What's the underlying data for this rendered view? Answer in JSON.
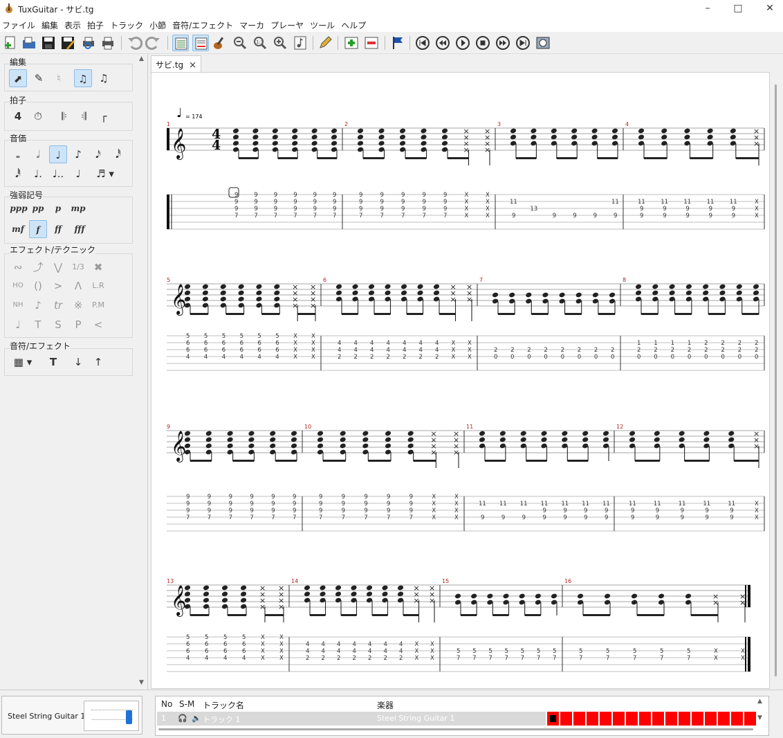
{
  "window": {
    "title": "TuxGuitar - サビ.tg"
  },
  "menu": [
    "ファイル",
    "編集",
    "表示",
    "拍子",
    "トラック",
    "小節",
    "音符/エフェクト",
    "マーカ",
    "プレーヤ",
    "ツール",
    "ヘルプ"
  ],
  "toolbar": {
    "buttons": [
      "new-file-icon",
      "open-file-icon",
      "save-icon",
      "save-as-icon",
      "print-preview-icon",
      "print-icon",
      "undo-icon",
      "redo-icon",
      "score-view-icon",
      "tab-view-icon",
      "fretboard-icon",
      "zoom-out-icon",
      "zoom-reset-icon",
      "zoom-in-icon",
      "note-icon",
      "pencil-icon",
      "add-track-icon",
      "remove-track-icon",
      "marker-flag-icon",
      "first-icon",
      "previous-icon",
      "play-icon",
      "stop-icon",
      "next-icon",
      "last-icon",
      "metronome-icon"
    ]
  },
  "tab": {
    "label": "サビ.tg",
    "close": "×"
  },
  "left_panel": {
    "groups": [
      {
        "label": "編集"
      },
      {
        "label": "拍子"
      },
      {
        "label": "音価"
      },
      {
        "label": "強弱記号",
        "items": [
          "ppp",
          "pp",
          "p",
          "mp",
          "mf",
          "f",
          "ff",
          "fff"
        ]
      },
      {
        "label": "エフェクト/テクニック",
        "items": [
          "1/3",
          "L.R",
          "tr",
          "P.M",
          "T",
          "S",
          "P",
          "<",
          "HO",
          "()",
          ">",
          "NH"
        ]
      },
      {
        "label": "音符/エフェクト"
      }
    ],
    "time_sig_icon": "4"
  },
  "score": {
    "tempo": "= 174",
    "time_signature": {
      "top": "4",
      "bottom": "4"
    },
    "measure_numbers": [
      "1",
      "2",
      "3",
      "4",
      "5",
      "6",
      "7",
      "8",
      "9",
      "10",
      "11",
      "12",
      "13",
      "14",
      "15",
      "16"
    ],
    "tab_measures": [
      [
        [
          "9",
          "9",
          "9",
          "7"
        ],
        [
          "9",
          "9",
          "9",
          "7"
        ],
        [
          "9",
          "9",
          "9",
          "7"
        ],
        [
          "9",
          "9",
          "9",
          "7"
        ],
        [
          "9",
          "9",
          "9",
          "7"
        ],
        [
          "9",
          "9",
          "9",
          "7"
        ]
      ],
      [
        [
          "9",
          "9",
          "9",
          "7"
        ],
        [
          "9",
          "9",
          "9",
          "7"
        ],
        [
          "9",
          "9",
          "9",
          "7"
        ],
        [
          "9",
          "9",
          "9",
          "7"
        ],
        [
          "9",
          "9",
          "9",
          "7"
        ],
        [
          "X",
          "X",
          "X",
          "X"
        ],
        [
          "X",
          "X",
          "X",
          "X"
        ]
      ],
      [
        [
          "11",
          "",
          "9"
        ],
        [
          "",
          "13",
          ""
        ],
        [
          "",
          "",
          "9"
        ],
        [
          "",
          "",
          "9"
        ],
        [
          "",
          "",
          "9"
        ],
        [
          "11",
          "",
          "9"
        ]
      ],
      [
        [
          "11",
          "9",
          "9"
        ],
        [
          "11",
          "9",
          "9"
        ],
        [
          "11",
          "9",
          "9"
        ],
        [
          "11",
          "9",
          "9"
        ],
        [
          "11",
          "9",
          "9"
        ],
        [
          "X",
          "X",
          "X"
        ]
      ],
      [
        [
          "5",
          "6",
          "6",
          "4"
        ],
        [
          "5",
          "6",
          "6",
          "4"
        ],
        [
          "5",
          "6",
          "6",
          "4"
        ],
        [
          "5",
          "6",
          "6",
          "4"
        ],
        [
          "5",
          "6",
          "6",
          "4"
        ],
        [
          "5",
          "6",
          "6",
          "4"
        ],
        [
          "X",
          "X",
          "X",
          "X"
        ],
        [
          "X",
          "X",
          "X",
          "X"
        ]
      ],
      [
        [
          "4",
          "4",
          "2"
        ],
        [
          "4",
          "4",
          "2"
        ],
        [
          "4",
          "4",
          "2"
        ],
        [
          "4",
          "4",
          "2"
        ],
        [
          "4",
          "4",
          "2"
        ],
        [
          "4",
          "4",
          "2"
        ],
        [
          "4",
          "4",
          "2"
        ],
        [
          "X",
          "X",
          "X"
        ],
        [
          "X",
          "X",
          "X"
        ]
      ],
      [
        [
          "2",
          "0"
        ],
        [
          "2",
          "0"
        ],
        [
          "2",
          "0"
        ],
        [
          "2",
          "0"
        ],
        [
          "2",
          "0"
        ],
        [
          "2",
          "0"
        ],
        [
          "2",
          "0"
        ],
        [
          "2",
          "0"
        ]
      ],
      [
        [
          "1",
          "2",
          "0"
        ],
        [
          "1",
          "2",
          "0"
        ],
        [
          "1",
          "2",
          "0"
        ],
        [
          "1",
          "2",
          "0"
        ],
        [
          "2",
          "2",
          "0"
        ],
        [
          "2",
          "2",
          "0"
        ],
        [
          "2",
          "2",
          "0"
        ],
        [
          "2",
          "2",
          "0"
        ]
      ],
      [
        [
          "9",
          "9",
          "9",
          "7"
        ],
        [
          "9",
          "9",
          "9",
          "7"
        ],
        [
          "9",
          "9",
          "9",
          "7"
        ],
        [
          "9",
          "9",
          "9",
          "7"
        ],
        [
          "9",
          "9",
          "9",
          "7"
        ],
        [
          "9",
          "9",
          "9",
          "7"
        ]
      ],
      [
        [
          "9",
          "9",
          "9",
          "7"
        ],
        [
          "9",
          "9",
          "9",
          "7"
        ],
        [
          "9",
          "9",
          "9",
          "7"
        ],
        [
          "9",
          "9",
          "9",
          "7"
        ],
        [
          "9",
          "9",
          "9",
          "7"
        ],
        [
          "X",
          "X",
          "X",
          "X"
        ],
        [
          "X",
          "X",
          "X",
          "X"
        ]
      ],
      [
        [
          "11",
          "",
          "9"
        ],
        [
          "11",
          "",
          "9"
        ],
        [
          "11",
          "",
          "9"
        ],
        [
          "11",
          "9",
          "9"
        ],
        [
          "11",
          "9",
          "9"
        ],
        [
          "11",
          "9",
          "9"
        ],
        [
          "11",
          "9",
          "9"
        ]
      ],
      [
        [
          "11",
          "9",
          "9"
        ],
        [
          "11",
          "9",
          "9"
        ],
        [
          "11",
          "9",
          "9"
        ],
        [
          "11",
          "9",
          "9"
        ],
        [
          "11",
          "9",
          "9"
        ],
        [
          "X",
          "X",
          "X"
        ]
      ],
      [
        [
          "5",
          "6",
          "6",
          "4"
        ],
        [
          "5",
          "6",
          "6",
          "4"
        ],
        [
          "5",
          "6",
          "6",
          "4"
        ],
        [
          "5",
          "6",
          "6",
          "4"
        ],
        [
          "X",
          "X",
          "X",
          "X"
        ],
        [
          "X",
          "X",
          "X",
          "X"
        ]
      ],
      [
        [
          "4",
          "4",
          "2"
        ],
        [
          "4",
          "4",
          "2"
        ],
        [
          "4",
          "4",
          "2"
        ],
        [
          "4",
          "4",
          "2"
        ],
        [
          "4",
          "4",
          "2"
        ],
        [
          "4",
          "4",
          "2"
        ],
        [
          "4",
          "4",
          "2"
        ],
        [
          "X",
          "X",
          "X"
        ],
        [
          "X",
          "X",
          "X"
        ]
      ],
      [
        [
          "5",
          "7"
        ],
        [
          "5",
          "7"
        ],
        [
          "5",
          "7"
        ],
        [
          "5",
          "7"
        ],
        [
          "5",
          "7"
        ],
        [
          "5",
          "7"
        ],
        [
          "5",
          "7"
        ]
      ],
      [
        [
          "5",
          "7"
        ],
        [
          "5",
          "7"
        ],
        [
          "5",
          "7"
        ],
        [
          "5",
          "7"
        ],
        [
          "5",
          "7"
        ],
        [
          "X",
          "X"
        ],
        [
          "X",
          "X"
        ]
      ]
    ]
  },
  "bottom": {
    "track_name": "Steel String Guitar 1",
    "headers": {
      "no": "No",
      "sm": "S-M",
      "track": "トラック名",
      "instrument": "楽器"
    },
    "row": {
      "no": "1",
      "track": "トラック 1",
      "instrument": "Steel String Guitar 1"
    },
    "measure_count": 16
  },
  "colors": {
    "accent": "#1e72d6",
    "measure_fill": "#ff0000",
    "measure_number": "#b22222",
    "active_bg": "#cde4f7"
  }
}
